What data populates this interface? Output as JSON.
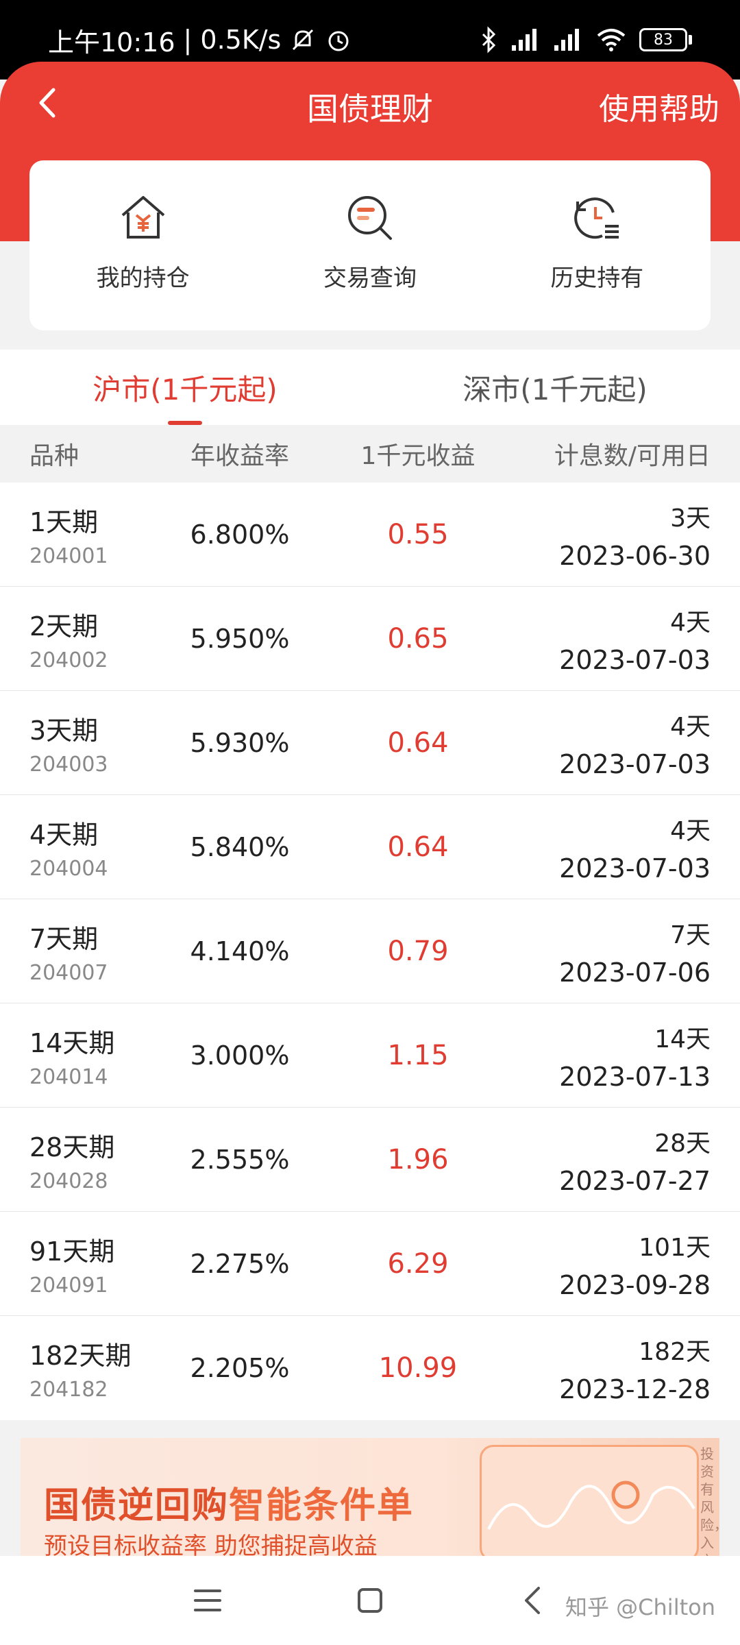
{
  "status_bar": {
    "time": "上午10:16",
    "net_speed": "| 0.5K/s",
    "battery": "83"
  },
  "nav": {
    "title": "国债理财",
    "help": "使用帮助"
  },
  "shortcuts": [
    {
      "label": "我的持仓",
      "icon": "house-yuan-icon"
    },
    {
      "label": "交易查询",
      "icon": "search-record-icon"
    },
    {
      "label": "历史持有",
      "icon": "history-clock-icon"
    }
  ],
  "tabs": [
    {
      "label": "沪市(1千元起)",
      "active": true
    },
    {
      "label": "深市(1千元起)",
      "active": false
    }
  ],
  "table": {
    "headers": [
      "品种",
      "年收益率",
      "1千元收益",
      "计息数/可用日"
    ],
    "rows": [
      {
        "name": "1天期",
        "code": "204001",
        "rate": "6.800%",
        "income": "0.55",
        "days": "3天",
        "date": "2023-06-30"
      },
      {
        "name": "2天期",
        "code": "204002",
        "rate": "5.950%",
        "income": "0.65",
        "days": "4天",
        "date": "2023-07-03"
      },
      {
        "name": "3天期",
        "code": "204003",
        "rate": "5.930%",
        "income": "0.64",
        "days": "4天",
        "date": "2023-07-03"
      },
      {
        "name": "4天期",
        "code": "204004",
        "rate": "5.840%",
        "income": "0.64",
        "days": "4天",
        "date": "2023-07-03"
      },
      {
        "name": "7天期",
        "code": "204007",
        "rate": "4.140%",
        "income": "0.79",
        "days": "7天",
        "date": "2023-07-06"
      },
      {
        "name": "14天期",
        "code": "204014",
        "rate": "3.000%",
        "income": "1.15",
        "days": "14天",
        "date": "2023-07-13"
      },
      {
        "name": "28天期",
        "code": "204028",
        "rate": "2.555%",
        "income": "1.96",
        "days": "28天",
        "date": "2023-07-27"
      },
      {
        "name": "91天期",
        "code": "204091",
        "rate": "2.275%",
        "income": "6.29",
        "days": "101天",
        "date": "2023-09-28"
      },
      {
        "name": "182天期",
        "code": "204182",
        "rate": "2.205%",
        "income": "10.99",
        "days": "182天",
        "date": "2023-12-28"
      }
    ]
  },
  "banner": {
    "title_part1": "国债逆回购",
    "title_part2": "智能条件单",
    "subtitle": "预设目标收益率 助您捕捉高收益",
    "side_text": "投资有风险，入市"
  },
  "watermark": "知乎 @Chilton",
  "colors": {
    "brand_red": "#ea3d33",
    "accent_red": "#e03c31"
  }
}
